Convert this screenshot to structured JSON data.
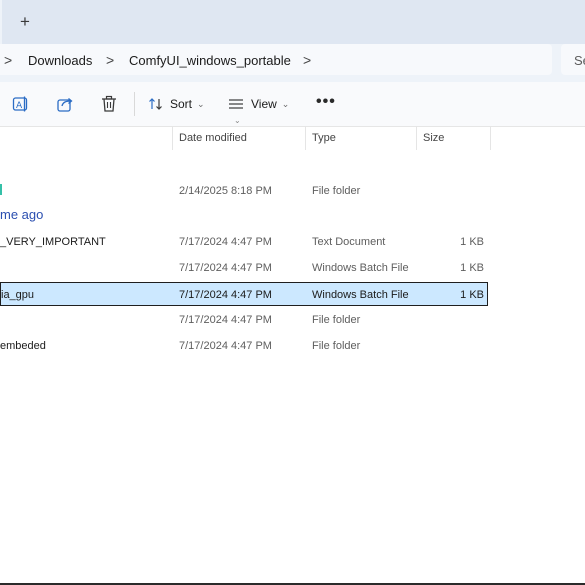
{
  "tabs": {
    "new_tab_label": "+"
  },
  "address": {
    "crumbs": [
      "Downloads",
      "ComfyUI_windows_portable"
    ],
    "separator": ">",
    "search_placeholder": "Se"
  },
  "toolbar": {
    "sort_label": "Sort",
    "view_label": "View",
    "more_label": "•••",
    "icons": [
      "rename-icon",
      "share-icon",
      "delete-icon",
      "sort-icon",
      "view-icon",
      "more-icon"
    ]
  },
  "columns": [
    "Date modified",
    "Type",
    "Size"
  ],
  "group_header": "me ago",
  "rows": [
    {
      "name": "",
      "date": "2/14/2025 8:18 PM",
      "type": "File folder",
      "size": ""
    },
    {
      "name": "_VERY_IMPORTANT",
      "date": "7/17/2024 4:47 PM",
      "type": "Text Document",
      "size": "1 KB"
    },
    {
      "name": "",
      "date": "7/17/2024 4:47 PM",
      "type": "Windows Batch File",
      "size": "1 KB"
    },
    {
      "name": "ia_gpu",
      "date": "7/17/2024 4:47 PM",
      "type": "Windows Batch File",
      "size": "1 KB"
    },
    {
      "name": "",
      "date": "7/17/2024 4:47 PM",
      "type": "File folder",
      "size": ""
    },
    {
      "name": "embeded",
      "date": "7/17/2024 4:47 PM",
      "type": "File folder",
      "size": ""
    }
  ],
  "colors": {
    "accent_group": "#2b4fb0",
    "selection_bg": "#cce8ff",
    "folder_accent": "#35c0a8"
  }
}
